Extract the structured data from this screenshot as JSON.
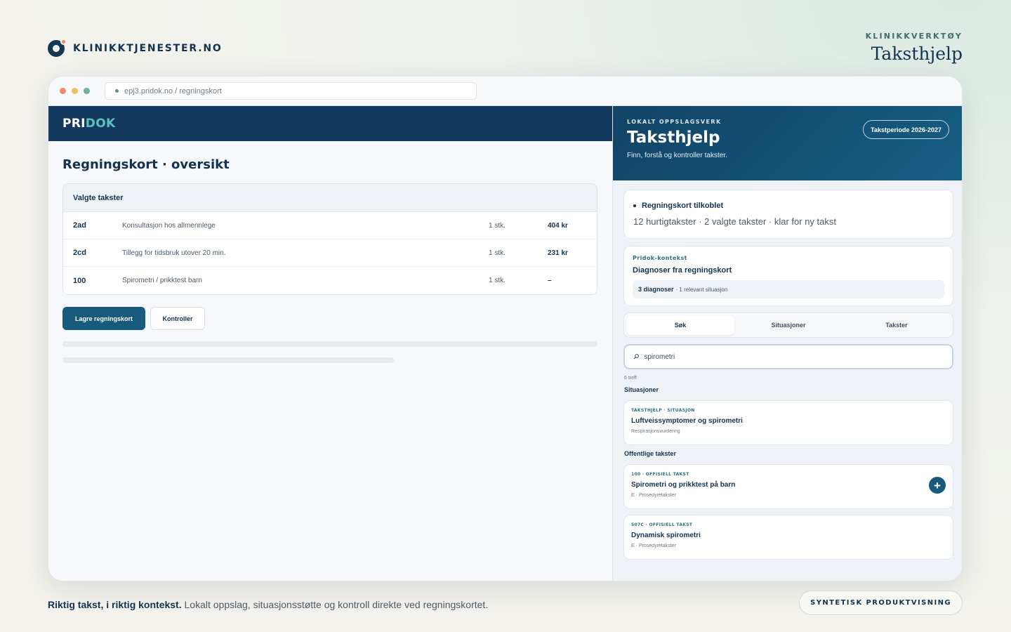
{
  "brand": {
    "name": "KLINIKKTJENESTER.NO",
    "icon": "brand-logo-icon"
  },
  "top_right": {
    "kicker": "KLINIKKVERKTØY",
    "title": "Taksthjelp"
  },
  "browser": {
    "url": "epj3.pridok.no / regningskort",
    "dot_colors": [
      "#ef8a6c",
      "#ecc15d",
      "#6fb09b"
    ]
  },
  "left_app": {
    "logo_pri": "PRI",
    "logo_dok": "DOK",
    "page_title": "Regningskort · oversikt",
    "table": {
      "header": "Valgte takster",
      "rows": [
        {
          "code": "2ad",
          "description": "Konsultasjon hos allmennlege",
          "qty": "1 stk.",
          "amount": "404 kr"
        },
        {
          "code": "2cd",
          "description": "Tillegg for tidsbruk utover 20 min.",
          "qty": "1 stk.",
          "amount": "231 kr"
        },
        {
          "code": "100",
          "description": "Spirometri / prikktest barn",
          "qty": "1 stk.",
          "amount": "–"
        }
      ]
    },
    "save_label": "Lagre regningskort",
    "check_label": "Kontroller"
  },
  "panel": {
    "kicker": "LOKALT OPPSLAGSVERK",
    "title": "Taksthjelp",
    "subtitle": "Finn, forstå og kontroller takster.",
    "period": "Takstperiode 2026-2027",
    "status": {
      "title": "Regningskort tilkoblet",
      "detail": "12 hurtigtakster · 2 valgte takster · klar for ny takst"
    },
    "context": {
      "kicker": "Pridok-kontekst",
      "title": "Diagnoser fra regningskort",
      "chip_bold": "3 diagnoser",
      "chip_rest": "· 1 relevant situasjon"
    },
    "tabs": [
      "Søk",
      "Situasjoner",
      "Takster"
    ],
    "search_value": "spirometri",
    "hits": "6 treff",
    "situations_label": "Situasjoner",
    "situation": {
      "kicker": "TAKSTHJELP · SITUASJON",
      "title": "Luftveissymptomer og spirometri",
      "sub": "Respirasjonsvurdering"
    },
    "public_label": "Offentlige takster",
    "takster": [
      {
        "kicker": "100 · OFFISIELL TAKST",
        "title": "Spirometri og prikktest på barn",
        "sub": "E · Prosedyretakster"
      },
      {
        "kicker": "507C · OFFISIELL TAKST",
        "title": "Dynamisk spirometri",
        "sub": "E · Prosedyretakster"
      }
    ]
  },
  "footer": {
    "bold": "Riktig takst, i riktig kontekst.",
    "rest": "Lokalt oppslag, situasjonsstøtte og kontroll direkte ved regningskortet.",
    "badge": "SYNTETISK PRODUKTVISNING"
  }
}
